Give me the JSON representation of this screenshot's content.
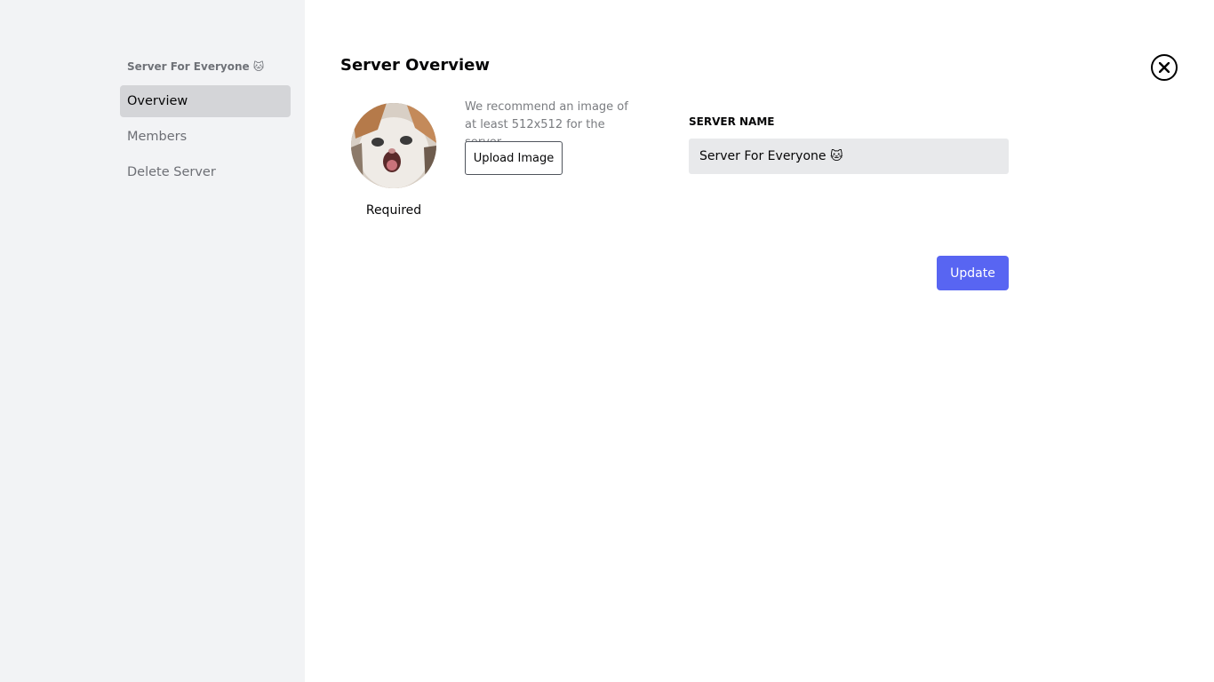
{
  "sidebar": {
    "server_name": "Server For Everyone 🐱",
    "items": [
      {
        "label": "Overview",
        "active": true
      },
      {
        "label": "Members",
        "active": false
      },
      {
        "label": "Delete Server",
        "active": false
      }
    ]
  },
  "main": {
    "title": "Server Overview",
    "avatar": {
      "required_label": "Required",
      "icon": "cat-avatar-image"
    },
    "hint": "We recommend an image of at least 512x512 for the server.",
    "upload_label": "Upload Image",
    "server_name_label": "SERVER NAME",
    "server_name_value": "Server For Everyone 🐱",
    "update_label": "Update",
    "close_icon": "close-circle-icon"
  },
  "colors": {
    "sidebar_bg": "#f2f3f5",
    "active_item_bg": "#d4d5d8",
    "input_bg": "#e8e9eb",
    "accent": "#5865f2"
  }
}
